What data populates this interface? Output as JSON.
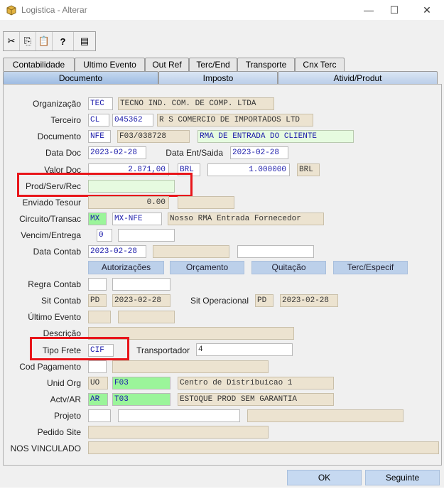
{
  "window": {
    "title": "Logistica - Alterar"
  },
  "window_controls": {
    "minimize": "—",
    "maximize": "☐",
    "close": "✕"
  },
  "tabs_row1": [
    "Contabilidade",
    "Ultimo Evento",
    "Out Ref",
    "Terc/End",
    "Transporte",
    "Cnx Terc"
  ],
  "tabs_row2": [
    "Documento",
    "Imposto",
    "Ativid/Produt"
  ],
  "labels": {
    "organizacao": "Organização",
    "terceiro": "Terceiro",
    "documento": "Documento",
    "data_doc": "Data Doc",
    "data_ent_saida": "Data Ent/Saida",
    "valor_doc": "Valor Doc",
    "prod_serv_rec": "Prod/Serv/Rec",
    "enviado_tesour": "Enviado Tesour",
    "circuito_transac": "Circuito/Transac",
    "vencim_entrega": "Vencim/Entrega",
    "data_contab": "Data Contab",
    "regra_contab": "Regra Contab",
    "sit_contab": "Sit Contab",
    "sit_operacional": "Sit Operacional",
    "ultimo_evento": "Último Evento",
    "descricao": "Descrição",
    "tipo_frete": "Tipo Frete",
    "transportador": "Transportador",
    "cod_pagamento": "Cod Pagamento",
    "unid_org": "Unid Org",
    "actv_ar": "Actv/AR",
    "projeto": "Projeto",
    "pedido_site": "Pedido Site",
    "nos_vinculado": "NOS VINCULADO"
  },
  "values": {
    "org_code": "TEC",
    "org_name": "TECNO IND. COM. DE COMP. LTDA",
    "terc_type": "CL",
    "terc_code": "045362",
    "terc_name": "R S COMERCIO DE IMPORTADOS LTD",
    "doc_type": "NFE",
    "doc_number": "F03/038728",
    "doc_desc": "RMA DE ENTRADA DO CLIENTE",
    "data_doc": "2023-02-28",
    "data_ent_saida": "2023-02-28",
    "valor_doc": "2.871,00",
    "moeda": "BRL",
    "taxa": "1.000000",
    "moeda2": "BRL",
    "enviado_tesour": "0.00",
    "circuito": "MX",
    "transac": "MX-NFE",
    "circuito_desc": "Nosso RMA Entrada Fornecedor",
    "vencim": "0",
    "data_contab": "2023-02-28",
    "sit_contab": "PD",
    "sit_contab_date": "2023-02-28",
    "sit_oper": "PD",
    "sit_oper_date": "2023-02-28",
    "tipo_frete": "CIF",
    "transportador": "4",
    "unid_org_type": "UO",
    "unid_org_code": "F03",
    "unid_org_desc": "Centro de Distribuicao 1",
    "actv_type": "AR",
    "actv_code": "T03",
    "actv_desc": "ESTOQUE PROD SEM GARANTIA"
  },
  "action_buttons": [
    "Autorizações",
    "Orçamento",
    "Quitação",
    "Terc/Especif"
  ],
  "footer": {
    "ok": "OK",
    "seguinte": "Seguinte"
  },
  "colors": {
    "highlight": "#e8151a",
    "tab_blue": "#b9cde8",
    "readonly": "#ece3d0",
    "green": "#9bf59a"
  }
}
